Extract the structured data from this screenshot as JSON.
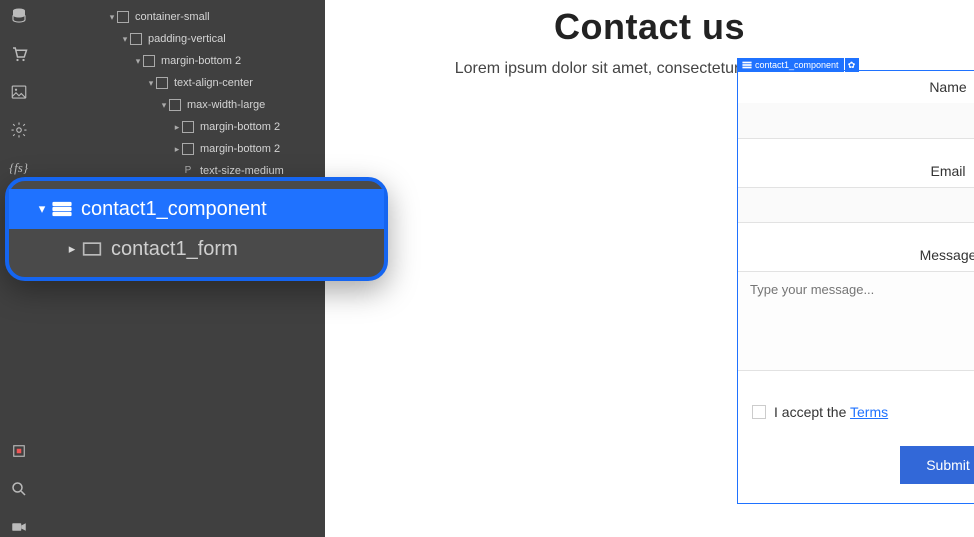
{
  "rail": {
    "icons": [
      "database",
      "cart",
      "image",
      "settings",
      "fs",
      "record",
      "search",
      "video"
    ]
  },
  "tree": {
    "items": [
      {
        "depth": 0,
        "arrow": "down",
        "icon": "box",
        "label": "container-small"
      },
      {
        "depth": 1,
        "arrow": "down",
        "icon": "box",
        "label": "padding-vertical"
      },
      {
        "depth": 2,
        "arrow": "down",
        "icon": "box",
        "label": "margin-bottom 2"
      },
      {
        "depth": 3,
        "arrow": "down",
        "icon": "box",
        "label": "text-align-center"
      },
      {
        "depth": 4,
        "arrow": "down",
        "icon": "box",
        "label": "max-width-large"
      },
      {
        "depth": 5,
        "arrow": "right",
        "icon": "box",
        "label": "margin-bottom 2"
      },
      {
        "depth": 5,
        "arrow": "right",
        "icon": "box",
        "label": "margin-bottom 2"
      },
      {
        "depth": 5,
        "arrow": "",
        "icon": "p",
        "label": "text-size-medium"
      }
    ]
  },
  "callout": {
    "row1": {
      "label": "contact1_component"
    },
    "row2": {
      "label": "contact1_form"
    }
  },
  "page": {
    "heading": "Contact us",
    "subheading": "Lorem ipsum dolor sit amet, consectetur adipiscing elit."
  },
  "badge": {
    "label": "contact1_component"
  },
  "form": {
    "name_label": "Name",
    "email_label": "Email",
    "message_label": "Message",
    "message_placeholder": "Type your message...",
    "checkbox_text": "I accept the ",
    "checkbox_link": "Terms",
    "submit_label": "Submit"
  }
}
